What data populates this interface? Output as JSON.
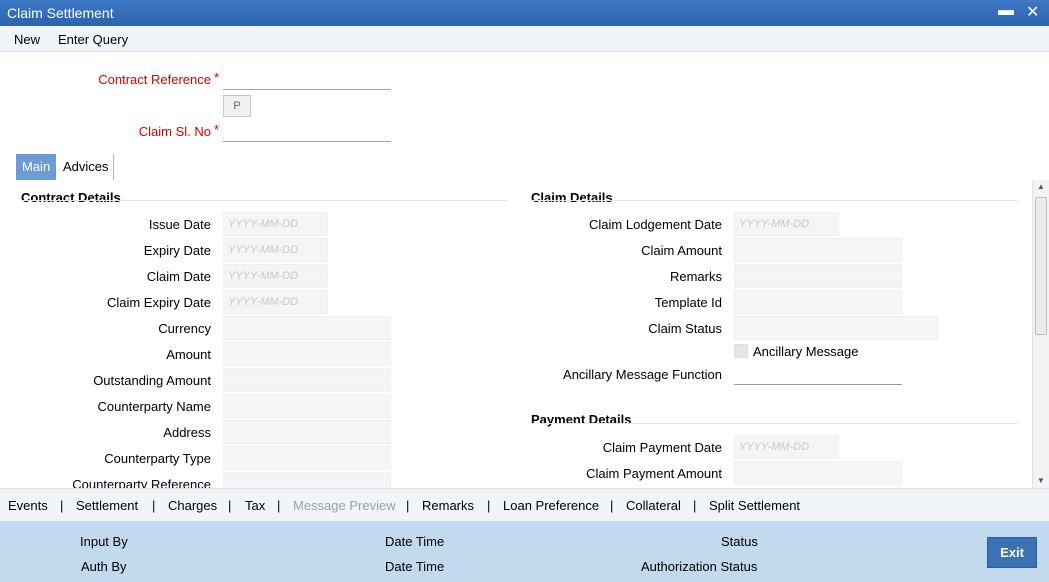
{
  "window": {
    "title": "Claim Settlement",
    "minimize_icon": "minimize-icon",
    "close_icon": "close-icon"
  },
  "menu": {
    "new_label": "New",
    "enter_query_label": "Enter Query"
  },
  "header_fields": {
    "contract_reference_label": "Contract Reference",
    "contract_reference_value": "",
    "p_button_label": "P",
    "claim_sl_no_label": "Claim Sl. No",
    "claim_sl_no_value": "",
    "required_marker": "*"
  },
  "tabs": [
    {
      "label": "Main",
      "active": true
    },
    {
      "label": "Advices",
      "active": false
    }
  ],
  "contract_details": {
    "title": "Contract Details",
    "fields": [
      {
        "label": "Issue Date",
        "placeholder": "YYYY-MM-DD"
      },
      {
        "label": "Expiry Date",
        "placeholder": "YYYY-MM-DD"
      },
      {
        "label": "Claim Date",
        "placeholder": "YYYY-MM-DD"
      },
      {
        "label": "Claim Expiry Date",
        "placeholder": "YYYY-MM-DD"
      },
      {
        "label": "Currency",
        "placeholder": ""
      },
      {
        "label": "Amount",
        "placeholder": ""
      },
      {
        "label": "Outstanding Amount",
        "placeholder": ""
      },
      {
        "label": "Counterparty Name",
        "placeholder": ""
      },
      {
        "label": "Address",
        "placeholder": ""
      },
      {
        "label": "Counterparty Type",
        "placeholder": ""
      },
      {
        "label": "Counterparty Reference",
        "placeholder": ""
      }
    ]
  },
  "claim_details": {
    "title": "Claim Details",
    "fields": [
      {
        "label": "Claim Lodgement Date",
        "placeholder": "YYYY-MM-DD"
      },
      {
        "label": "Claim Amount",
        "placeholder": ""
      },
      {
        "label": "Remarks",
        "placeholder": ""
      },
      {
        "label": "Template Id",
        "placeholder": ""
      },
      {
        "label": "Claim Status",
        "placeholder": ""
      }
    ],
    "ancillary_message_label": "Ancillary Message",
    "ancillary_message_checked": false,
    "ancillary_message_function_label": "Ancillary Message Function",
    "ancillary_message_function_value": ""
  },
  "payment_details": {
    "title": "Payment Details",
    "fields": [
      {
        "label": "Claim Payment Date",
        "placeholder": "YYYY-MM-DD"
      },
      {
        "label": "Claim Payment Amount",
        "placeholder": ""
      }
    ]
  },
  "bottom_links": [
    {
      "label": "Events",
      "enabled": true
    },
    {
      "label": "Settlement",
      "enabled": true
    },
    {
      "label": "Charges",
      "enabled": true
    },
    {
      "label": "Tax",
      "enabled": true
    },
    {
      "label": "Message Preview",
      "enabled": false
    },
    {
      "label": "Remarks",
      "enabled": true
    },
    {
      "label": "Loan Preference",
      "enabled": true
    },
    {
      "label": "Collateral",
      "enabled": true
    },
    {
      "label": "Split Settlement",
      "enabled": true
    }
  ],
  "link_separator": "|",
  "footer": {
    "input_by_label": "Input By",
    "auth_by_label": "Auth By",
    "date_time_label_1": "Date Time",
    "date_time_label_2": "Date Time",
    "status_label": "Status",
    "authorization_status_label": "Authorization Status",
    "exit_label": "Exit"
  },
  "colors": {
    "title_bar": "#2f67b1",
    "active_tab": "#6c9cd3",
    "mandatory_label": "#d40000",
    "footer_bg": "#c2d9ee",
    "exit_button": "#3c72b4"
  }
}
